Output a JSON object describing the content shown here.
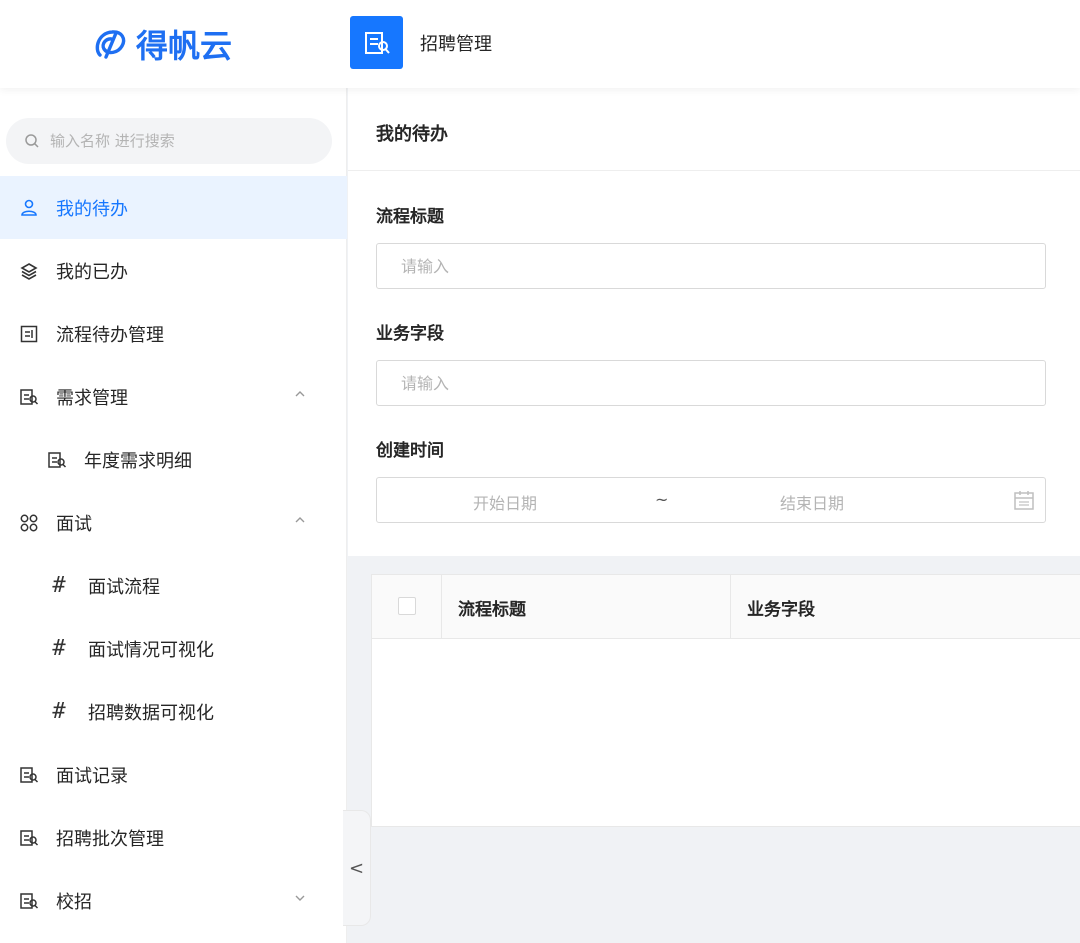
{
  "header": {
    "logo_text": "得帆云",
    "app_title": "招聘管理",
    "colors": {
      "brand": "#1e6ff2",
      "accent": "#1677ff"
    }
  },
  "sidebar": {
    "search_placeholder": "输入名称 进行搜索",
    "items": [
      {
        "label": "我的待办",
        "icon": "user-icon",
        "active": true
      },
      {
        "label": "我的已办",
        "icon": "layers-icon"
      },
      {
        "label": "流程待办管理",
        "icon": "form-icon"
      },
      {
        "label": "需求管理",
        "icon": "form-icon",
        "expanded": true
      },
      {
        "label": "年度需求明细",
        "icon": "form-icon"
      },
      {
        "label": "面试",
        "icon": "grid-icon",
        "expanded": true
      },
      {
        "label": "面试流程",
        "icon": "hash-icon"
      },
      {
        "label": "面试情况可视化",
        "icon": "hash-icon"
      },
      {
        "label": "招聘数据可视化",
        "icon": "hash-icon"
      },
      {
        "label": "面试记录",
        "icon": "form-icon"
      },
      {
        "label": "招聘批次管理",
        "icon": "form-icon"
      },
      {
        "label": "校招",
        "icon": "form-icon",
        "expanded": false
      }
    ],
    "hash_glyph": "#",
    "collapse_glyph": "<"
  },
  "main": {
    "title": "我的待办",
    "fields": {
      "process_title_label": "流程标题",
      "process_title_placeholder": "请输入",
      "business_field_label": "业务字段",
      "business_field_placeholder": "请输入",
      "created_time_label": "创建时间",
      "start_date_placeholder": "开始日期",
      "range_separator": "~",
      "end_date_placeholder": "结束日期"
    },
    "table": {
      "columns": [
        "流程标题",
        "业务字段"
      ],
      "rows": []
    }
  }
}
